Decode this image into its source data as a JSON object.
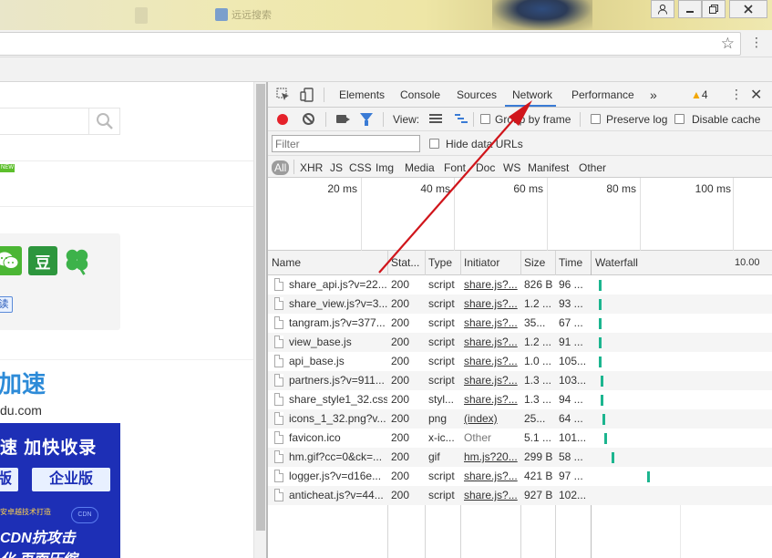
{
  "browser": {
    "tab_ghost_text": "远远搜索",
    "window_buttons": [
      "user",
      "minimize",
      "maximize",
      "close"
    ]
  },
  "page": {
    "new_badge": "NEW",
    "read_tag": "读",
    "douban_glyph": "豆",
    "ad_top": {
      "big": "加速",
      "domain": "du.com"
    },
    "ad_blue": {
      "row1": "速  加快收录",
      "btn1": "版",
      "btn2": "企业版",
      "small": "安卓越技术打造",
      "cdn": "CDN抗攻击",
      "cdn_pill": "CDN",
      "row4": "化 页面压缩"
    }
  },
  "devtools": {
    "tabs": [
      "Elements",
      "Console",
      "Sources",
      "Network",
      "Performance"
    ],
    "active_tab": "Network",
    "more": "»",
    "warning_count": "4",
    "toolbar": {
      "view_label": "View:",
      "group_by_frame": "Group by frame",
      "preserve_log": "Preserve log",
      "disable_cache": "Disable cache"
    },
    "filter": {
      "placeholder": "Filter",
      "hide_data_urls": "Hide data URLs"
    },
    "types": [
      "All",
      "XHR",
      "JS",
      "CSS",
      "Img",
      "Media",
      "Font",
      "Doc",
      "WS",
      "Manifest",
      "Other"
    ],
    "active_type": "All",
    "overview_ticks": [
      "20 ms",
      "40 ms",
      "60 ms",
      "80 ms",
      "100 ms"
    ],
    "columns": [
      "Name",
      "Stat...",
      "Type",
      "Initiator",
      "Size",
      "Time",
      "Waterfall"
    ],
    "waterfall_scale": "10.00",
    "requests": [
      {
        "name": "share_api.js?v=22...",
        "status": "200",
        "type": "script",
        "initiator": "share.js?...",
        "size": "826 B",
        "time": "96 ...",
        "wf_start": 0.03
      },
      {
        "name": "share_view.js?v=3...",
        "status": "200",
        "type": "script",
        "initiator": "share.js?...",
        "size": "1.2 ...",
        "time": "93 ...",
        "wf_start": 0.03
      },
      {
        "name": "tangram.js?v=377...",
        "status": "200",
        "type": "script",
        "initiator": "share.js?...",
        "size": "35...",
        "time": "67 ...",
        "wf_start": 0.03
      },
      {
        "name": "view_base.js",
        "status": "200",
        "type": "script",
        "initiator": "share.js?...",
        "size": "1.2 ...",
        "time": "91 ...",
        "wf_start": 0.03
      },
      {
        "name": "api_base.js",
        "status": "200",
        "type": "script",
        "initiator": "share.js?...",
        "size": "1.0 ...",
        "time": "105...",
        "wf_start": 0.03
      },
      {
        "name": "partners.js?v=911...",
        "status": "200",
        "type": "script",
        "initiator": "share.js?...",
        "size": "1.3 ...",
        "time": "103...",
        "wf_start": 0.04
      },
      {
        "name": "share_style1_32.css",
        "status": "200",
        "type": "styl...",
        "initiator": "share.js?...",
        "size": "1.3 ...",
        "time": "94 ...",
        "wf_start": 0.04
      },
      {
        "name": "icons_1_32.png?v...",
        "status": "200",
        "type": "png",
        "initiator": "(index)",
        "size": "25...",
        "time": "64 ...",
        "wf_start": 0.05
      },
      {
        "name": "favicon.ico",
        "status": "200",
        "type": "x-ic...",
        "initiator": "Other",
        "size": "5.1 ...",
        "time": "101...",
        "wf_start": 0.06
      },
      {
        "name": "hm.gif?cc=0&ck=...",
        "status": "200",
        "type": "gif",
        "initiator": "hm.js?20...",
        "size": "299 B",
        "time": "58 ...",
        "wf_start": 0.1
      },
      {
        "name": "logger.js?v=d16e...",
        "status": "200",
        "type": "script",
        "initiator": "share.js?...",
        "size": "421 B",
        "time": "97 ...",
        "wf_start": 0.3
      },
      {
        "name": "anticheat.js?v=44...",
        "status": "200",
        "type": "script",
        "initiator": "share.js?...",
        "size": "927 B",
        "time": "102...",
        "wf_start": 1.0
      }
    ]
  },
  "colors": {
    "accent": "#3a7bd5",
    "record": "#e5212a",
    "waterfall": "#1cb58f",
    "annotation_arrow": "#d0151b"
  }
}
